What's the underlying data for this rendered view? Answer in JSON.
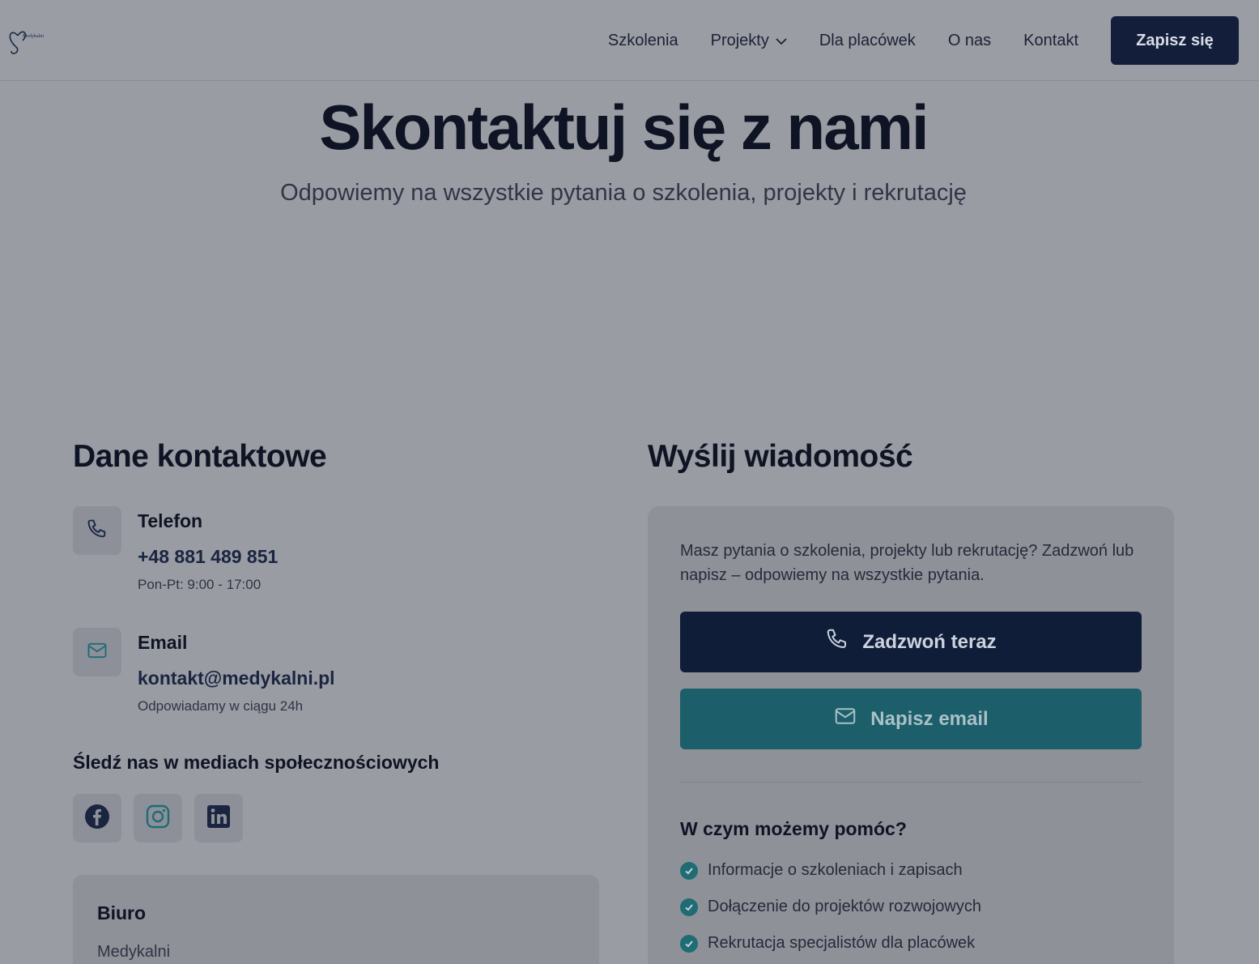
{
  "header": {
    "logo_text": "Medykalni",
    "nav": [
      "Szkolenia",
      "Projekty",
      "Dla placówek",
      "O nas",
      "Kontakt"
    ],
    "cta": "Zapisz się"
  },
  "hero": {
    "title": "Skontaktuj się z nami",
    "subtitle": "Odpowiemy na wszystkie pytania o szkolenia, projekty i rekrutację"
  },
  "contact": {
    "title": "Dane kontaktowe",
    "phone": {
      "label": "Telefon",
      "value": "+48 881 489 851",
      "note": "Pon-Pt: 9:00 - 17:00"
    },
    "email": {
      "label": "Email",
      "value": "kontakt@medykalni.pl",
      "note": "Odpowiadamy w ciągu 24h"
    },
    "social_title": "Śledź nas w mediach społecznościowych",
    "social_icons": [
      "facebook-icon",
      "instagram-icon",
      "linkedin-icon"
    ],
    "office": {
      "title": "Biuro",
      "line1": "Medykalni"
    }
  },
  "message": {
    "title": "Wyślij wiadomość",
    "intro": "Masz pytania o szkolenia, projekty lub rekrutację? Zadzwoń lub napisz – odpowiemy na wszystkie pytania.",
    "call_button": "Zadzwoń teraz",
    "email_button": "Napisz email",
    "help_title": "W czym możemy pomóc?",
    "help_items": [
      "Informacje o szkoleniach i zapisach",
      "Dołączenie do projektów rozwojowych",
      "Rekrutacja specjalistów dla placówek"
    ]
  },
  "colors": {
    "overlay_bg": "#9a9ca3",
    "primary_navy": "#101d38",
    "teal": "#1c5e69"
  }
}
